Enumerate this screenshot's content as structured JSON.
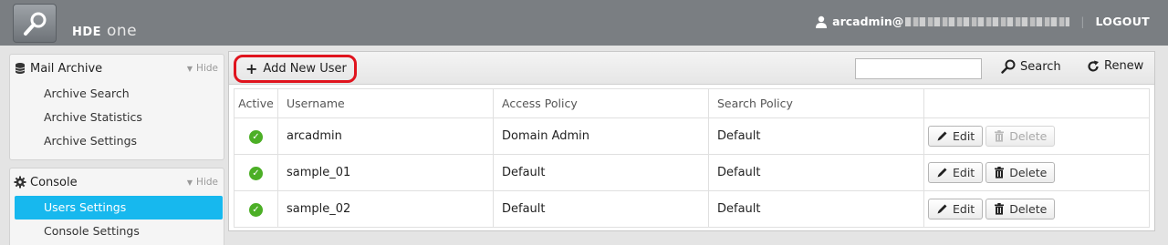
{
  "header": {
    "brand_bold": "HDE",
    "brand_light": "one",
    "user_prefix": "arcadmin@",
    "separator": "|",
    "logout": "LOGOUT"
  },
  "sidebar": {
    "sections": [
      {
        "title": "Mail Archive",
        "hide": "Hide",
        "items": [
          {
            "label": "Archive Search"
          },
          {
            "label": "Archive Statistics"
          },
          {
            "label": "Archive Settings"
          }
        ]
      },
      {
        "title": "Console",
        "hide": "Hide",
        "items": [
          {
            "label": "Users Settings",
            "active": true
          },
          {
            "label": "Console Settings"
          }
        ]
      }
    ]
  },
  "toolbar": {
    "add_label": "Add New User",
    "search_value": "",
    "search_label": "Search",
    "renew_label": "Renew"
  },
  "table": {
    "columns": [
      "Active",
      "Username",
      "Access Policy",
      "Search Policy",
      ""
    ],
    "rows": [
      {
        "username": "arcadmin",
        "access_policy": "Domain Admin",
        "search_policy": "Default",
        "active": true,
        "edit": "Edit",
        "delete": "Delete",
        "delete_enabled": false
      },
      {
        "username": "sample_01",
        "access_policy": "Default",
        "search_policy": "Default",
        "active": true,
        "edit": "Edit",
        "delete": "Delete",
        "delete_enabled": true
      },
      {
        "username": "sample_02",
        "access_policy": "Default",
        "search_policy": "Default",
        "active": true,
        "edit": "Edit",
        "delete": "Delete",
        "delete_enabled": true
      }
    ]
  },
  "colors": {
    "header_bg": "#7a7e82",
    "active_item": "#17b8ee",
    "highlight_border": "#e0141e",
    "check_green": "#4caf26"
  }
}
